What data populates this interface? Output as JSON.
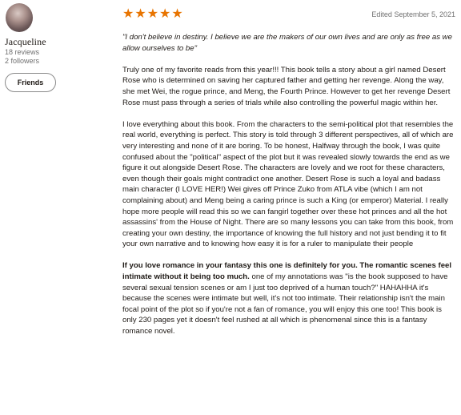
{
  "reviewer": {
    "name": "Jacqueline",
    "reviews": "18 reviews",
    "followers": "2 followers",
    "friends_button": "Friends"
  },
  "review": {
    "rating": 5,
    "stars": [
      "★",
      "★",
      "★",
      "★",
      "★"
    ],
    "star_color": "#e87400",
    "edited": "Edited September 5, 2021",
    "quote": "\"I don't believe in destiny. I believe we are the makers of our own lives and are only as free as we allow ourselves to be\"",
    "p1": "Truly one of my favorite reads from this year!!! This book tells a story about a girl named Desert Rose who is determined on saving her captured father and getting her revenge. Along the way, she met Wei, the rogue prince, and Meng, the Fourth Prince. However to get her revenge Desert Rose must pass through a series of trials while also controlling the powerful magic within her.",
    "p2": "I love everything about this book. From the characters to the semi-political plot that resembles the real world, everything is perfect. This story is told through 3 different perspectives, all of which are very interesting and none of it are boring. To be honest, Halfway through the book, I was quite confused about the \"political\" aspect of the plot but it was revealed slowly towards the end as we figure it out alongside Desert Rose. The characters are lovely and we root for these characters, even though their goals might contradict one another. Desert Rose is such a loyal and badass main character (I LOVE HER!) Wei gives off Prince Zuko from ATLA vibe (which I am not complaining about) and Meng being a caring prince is such a King (or emperor) Material. I really hope more people will read this so we can fangirl together over these hot princes and all the hot assassins' from the House of Night. There are so many lessons you can take from this book, from creating your own destiny, the importance of knowing the full history and not just bending it to fit your own narrative and to knowing how easy it is for a ruler to manipulate their people",
    "p3_bold": "If you love romance in your fantasy this one is definitely for you. The romantic scenes feel intimate without it being too much.",
    "p3_rest": " one of my annotations was \"is the book supposed to have several sexual tension scenes or am I just too deprived of a human touch?\" HAHAHHA it's because the scenes were intimate but well, it's not too intimate. Their relationship isn't the main focal point of the plot so if you're not a fan of romance, you will enjoy this one too! This book is only 230 pages yet it doesn't feel rushed at all which is phenomenal since this is a fantasy romance novel."
  }
}
